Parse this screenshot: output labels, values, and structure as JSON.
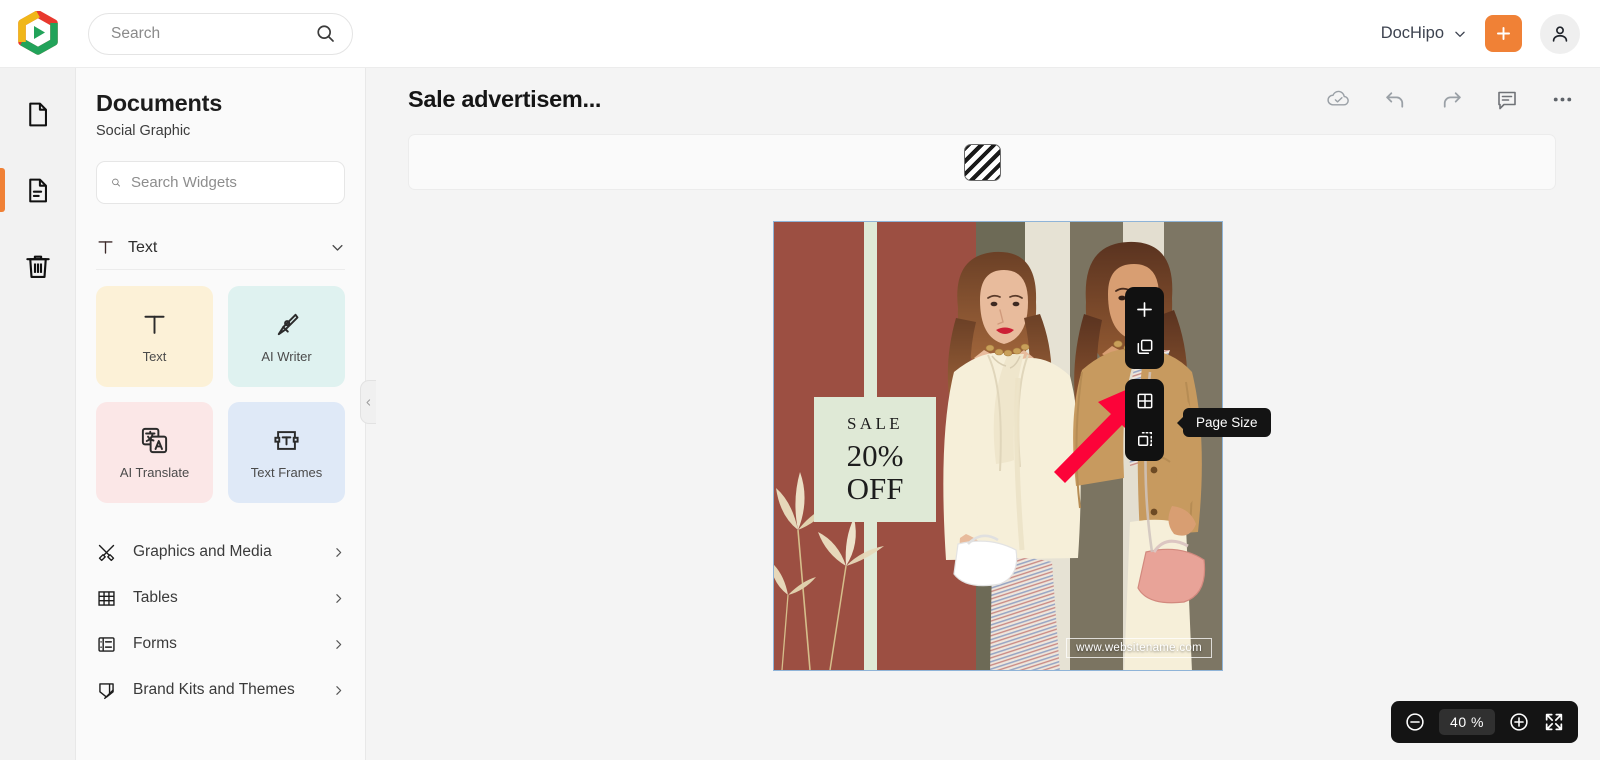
{
  "topbar": {
    "search": {
      "value": "",
      "placeholder": "Search",
      "icon": "search-icon"
    },
    "brand": {
      "label": "DocHipo",
      "chevron": "chevron-down-icon"
    },
    "add_button": {
      "icon": "plus-icon",
      "color": "#f08136"
    },
    "account": {
      "icon": "user-icon"
    }
  },
  "rail": {
    "items": [
      {
        "name": "blank-page",
        "icon": "page-icon",
        "active": false
      },
      {
        "name": "documents",
        "icon": "document-lines-icon",
        "active": true
      },
      {
        "name": "trash",
        "icon": "trash-icon",
        "active": false
      }
    ]
  },
  "panel": {
    "title": "Documents",
    "subtitle": "Social Graphic",
    "search": {
      "value": "",
      "placeholder": "Search Widgets",
      "icon": "search-icon"
    },
    "section": {
      "label": "Text",
      "icon": "text-t-icon",
      "chevron": "chevron-down-icon",
      "expanded": true
    },
    "cards": [
      {
        "label": "Text",
        "icon": "text-t-icon",
        "bg": "#fcf1d7"
      },
      {
        "label": "AI Writer",
        "icon": "pen-nib-icon",
        "bg": "#dff2f0"
      },
      {
        "label": "AI Translate",
        "icon": "translate-icon",
        "bg": "#fbe7e7"
      },
      {
        "label": "Text Frames",
        "icon": "text-frame-icon",
        "bg": "#dfe9f7"
      }
    ],
    "menu": [
      {
        "label": "Graphics and Media",
        "icon": "graphics-media-icon",
        "chevron": "chevron-right-icon"
      },
      {
        "label": "Tables",
        "icon": "table-grid-icon",
        "chevron": "chevron-right-icon"
      },
      {
        "label": "Forms",
        "icon": "form-icon",
        "chevron": "chevron-right-icon"
      },
      {
        "label": "Brand Kits and Themes",
        "icon": "brand-kit-icon",
        "chevron": "chevron-right-icon"
      }
    ],
    "collapse": {
      "icon": "chevron-left-icon"
    }
  },
  "editor": {
    "document_title": "Sale advertisem...",
    "tools": [
      {
        "name": "cloud-save",
        "icon": "cloud-check-icon"
      },
      {
        "name": "undo",
        "icon": "undo-arrow-icon"
      },
      {
        "name": "redo",
        "icon": "redo-arrow-icon"
      },
      {
        "name": "comments",
        "icon": "comment-icon"
      },
      {
        "name": "more-options",
        "icon": "ellipsis-icon"
      }
    ],
    "property_bar": {
      "swatch": {
        "name": "background-pattern-swatch",
        "icon": "diagonal-stripes-icon"
      }
    }
  },
  "page_tools": {
    "groups": [
      [
        {
          "name": "add-page",
          "icon": "plus-icon"
        },
        {
          "name": "duplicate-page",
          "icon": "copy-icon"
        }
      ],
      [
        {
          "name": "page-layout",
          "icon": "grid-four-icon"
        },
        {
          "name": "page-size",
          "icon": "resize-dashed-icon",
          "active": true
        }
      ]
    ],
    "tooltip": "Page Size"
  },
  "annotation": {
    "arrow": {
      "name": "pointer-arrow",
      "color": "#fc0339",
      "points_to": "page-size"
    }
  },
  "canvas": {
    "artwork": {
      "sale_badge": {
        "eyebrow": "SALE",
        "amount": "20%",
        "suffix": "OFF",
        "bg": "#dfe9d6"
      },
      "website": "www.websitename.com",
      "stripe_colors": [
        "#9c4f42",
        "#dfe9d6",
        "#9c4f42",
        "#6e6a57",
        "#e8e4d6",
        "#6e6a57",
        "#d9d3c4"
      ]
    }
  },
  "zoom_bar": {
    "zoom_out": {
      "icon": "minus-circle-icon"
    },
    "value": "40  %",
    "zoom_in": {
      "icon": "plus-circle-icon"
    },
    "fullscreen": {
      "icon": "expand-arrows-icon"
    }
  }
}
